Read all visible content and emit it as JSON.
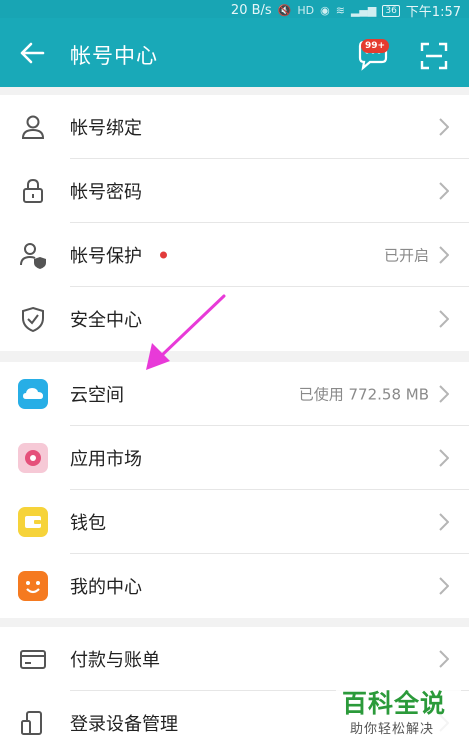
{
  "status_bar": {
    "speed": "20 B/s",
    "battery": "36",
    "time": "下午1:57",
    "icons": [
      "mute-icon",
      "hd-icon",
      "eye-icon",
      "wifi-icon",
      "signal-icon",
      "battery-icon"
    ]
  },
  "app_bar": {
    "title": "帐号中心",
    "message_badge": "99+",
    "background": "#19a9b8"
  },
  "account_section": [
    {
      "icon": "person-icon",
      "label": "帐号绑定",
      "value": ""
    },
    {
      "icon": "lock-icon",
      "label": "帐号密码",
      "value": ""
    },
    {
      "icon": "person-shield-icon",
      "label": "帐号保护",
      "value": "已开启"
    },
    {
      "icon": "shield-icon",
      "label": "安全中心",
      "value": ""
    }
  ],
  "services_section": [
    {
      "icon": "cloud-icon",
      "label": "云空间",
      "value": "已使用 772.58 MB"
    },
    {
      "icon": "appmarket-icon",
      "label": "应用市场",
      "value": ""
    },
    {
      "icon": "wallet-icon",
      "label": "钱包",
      "value": ""
    },
    {
      "icon": "smile-icon",
      "label": "我的中心",
      "value": ""
    }
  ],
  "payment_section": [
    {
      "icon": "card-icon",
      "label": "付款与账单",
      "value": ""
    },
    {
      "icon": "devices-icon",
      "label": "登录设备管理",
      "value": ""
    }
  ],
  "watermark": {
    "title": "百科全说",
    "subtitle": "助你轻松解决"
  },
  "colors": {
    "accent": "#19a9b8",
    "annotation_arrow": "#e83ad8",
    "alert_dot": "#e23b3b"
  }
}
